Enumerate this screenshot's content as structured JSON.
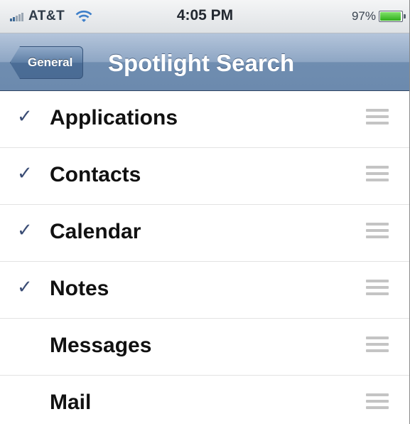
{
  "status_bar": {
    "carrier": "AT&T",
    "time": "4:05 PM",
    "battery_percent": "97%",
    "battery_level": 0.97,
    "icons": [
      "signal-icon",
      "wifi-icon",
      "battery-icon"
    ]
  },
  "nav_bar": {
    "back_label": "General",
    "title": "Spotlight Search"
  },
  "list": {
    "items": [
      {
        "label": "Applications",
        "checked": true
      },
      {
        "label": "Contacts",
        "checked": true
      },
      {
        "label": "Calendar",
        "checked": true
      },
      {
        "label": "Notes",
        "checked": true
      },
      {
        "label": "Messages",
        "checked": false
      },
      {
        "label": "Mail",
        "checked": false
      }
    ],
    "check_glyph": "✓",
    "reorder_icon": "reorder-grip-icon"
  },
  "colors": {
    "nav_bar": "#6f8db0",
    "check": "#3b4d75",
    "battery_fill": "#2fae1b"
  }
}
